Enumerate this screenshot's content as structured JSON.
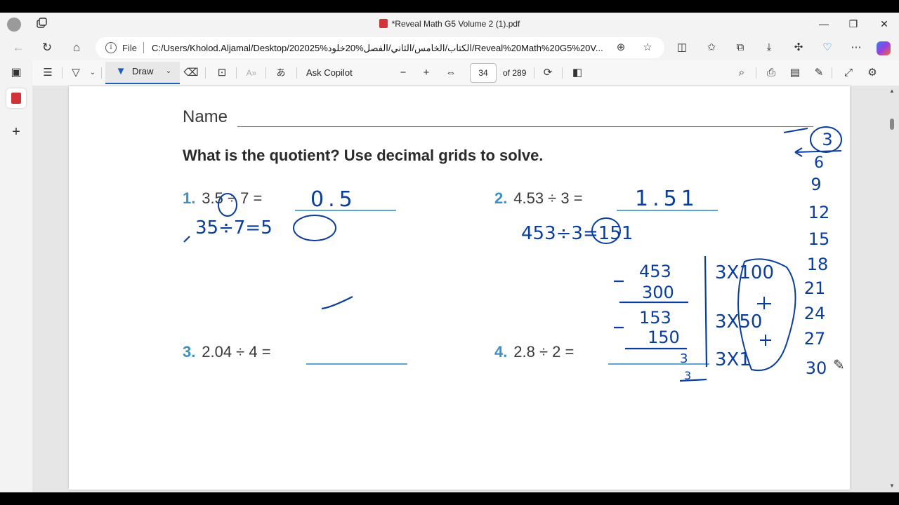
{
  "window": {
    "title": "*Reveal Math G5 Volume 2 (1).pdf",
    "minimize_glyph": "—",
    "restore_glyph": "❐",
    "close_glyph": "✕"
  },
  "address_bar": {
    "scheme_label": "File",
    "url": "C:/Users/Kholod.Aljamal/Desktop/الكتاب/الخامس/الثاني/الفصل%20خلود%202025/Reveal%20Math%20G5%20V...",
    "info_glyph": "i"
  },
  "pdf_toolbar": {
    "draw_label": "Draw",
    "ask_copilot_label": "Ask Copilot",
    "page_number": "34",
    "page_count_label": "of 289"
  },
  "document": {
    "name_label": "Name",
    "heading": "What is the quotient? Use decimal grids to solve.",
    "problems": [
      {
        "number": "1.",
        "expression": "3.5 ÷ 7 ="
      },
      {
        "number": "2.",
        "expression": "4.53 ÷ 3 ="
      },
      {
        "number": "3.",
        "expression": "2.04 ÷ 4 ="
      },
      {
        "number": "4.",
        "expression": "2.8 ÷ 2 ="
      }
    ],
    "handwriting": {
      "p1_answer": "0.5",
      "p1_rewrite": "35÷7=5",
      "p2_answer": "1.51",
      "p2_rewrite": "453÷3=151",
      "long_division": [
        "453",
        "300",
        "153",
        "150",
        "3",
        "3"
      ],
      "partials": [
        "3X100",
        "3X50",
        "3X1"
      ],
      "skip_count": [
        "3",
        "6",
        "9",
        "12",
        "15",
        "18",
        "21",
        "24",
        "27",
        "30"
      ]
    }
  },
  "colors": {
    "ink": "#0a3d9c",
    "accent_blue": "#3f8fc0",
    "toolbar_bg": "#f3f3f3"
  },
  "icons": [
    "profile-avatar-icon",
    "tab-actions-icon",
    "back-icon",
    "refresh-icon",
    "home-icon",
    "info-icon",
    "zoom-icon",
    "favorite-icon",
    "split-screen-icon",
    "favorites-icon",
    "collections-icon",
    "downloads-icon",
    "extensions-icon",
    "browser-essentials-icon",
    "more-icon",
    "copilot-icon",
    "sidebar-toggle-icon",
    "pdf-tab-icon",
    "add-tab-icon",
    "contents-icon",
    "highlight-icon",
    "draw-icon",
    "eraser-icon",
    "text-icon",
    "read-aloud-icon",
    "translate-icon",
    "zoom-out-icon",
    "zoom-in-icon",
    "fit-width-icon",
    "rotate-icon",
    "page-view-icon",
    "search-icon",
    "print-icon",
    "save-icon",
    "save-as-icon",
    "fullscreen-icon",
    "settings-icon",
    "pen-cursor-icon"
  ]
}
